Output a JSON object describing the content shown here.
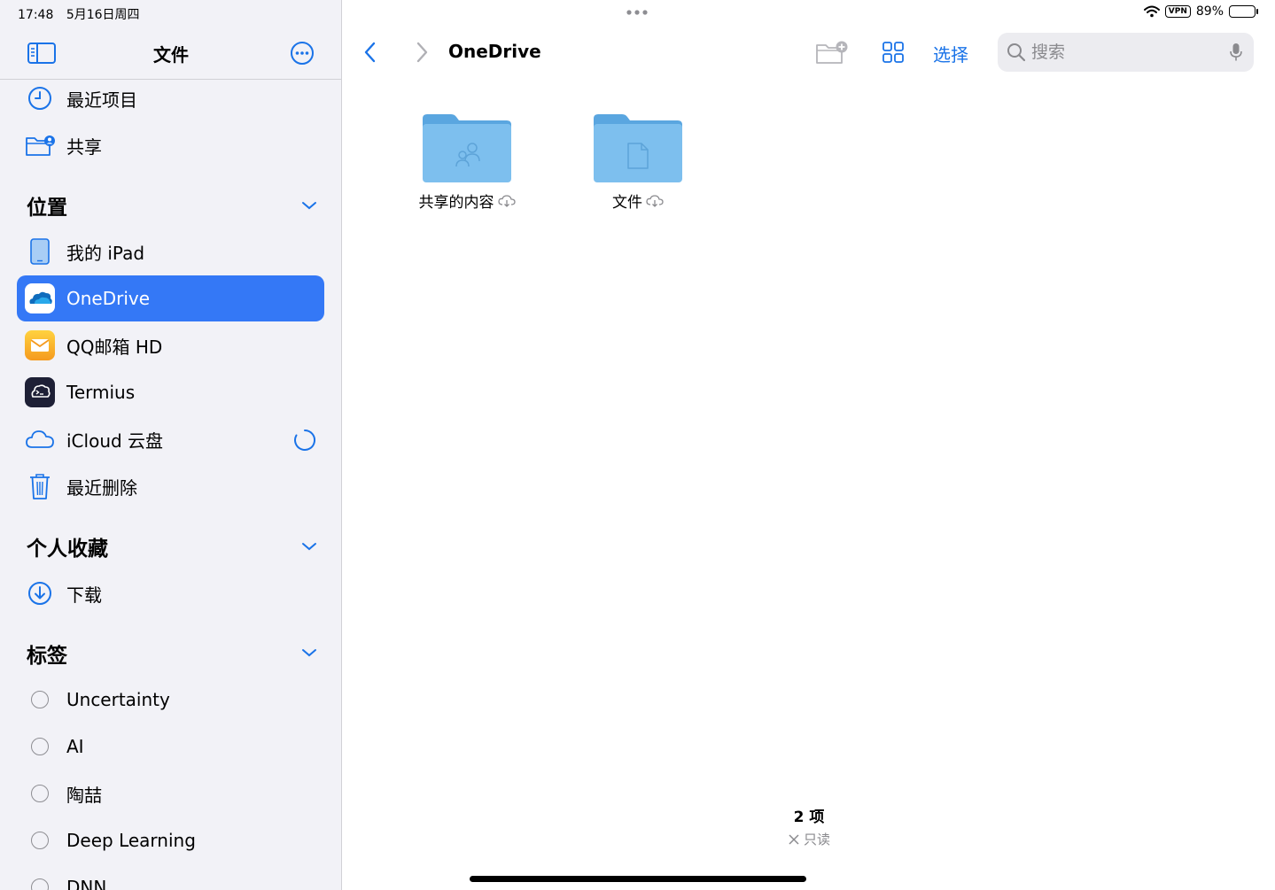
{
  "status": {
    "time": "17:48",
    "date": "5月16日周四",
    "vpn": "VPN",
    "battery": "89%",
    "battery_level": 0.89
  },
  "sidebar": {
    "title": "文件",
    "quick": [
      {
        "label": "最近项目",
        "icon": "clock-icon"
      },
      {
        "label": "共享",
        "icon": "shared-folder-icon"
      }
    ],
    "locations_header": "位置",
    "locations": [
      {
        "label": "我的 iPad",
        "icon": "ipad-icon"
      },
      {
        "label": "OneDrive",
        "icon": "onedrive-icon",
        "selected": true
      },
      {
        "label": "QQ邮箱 HD",
        "icon": "mail-icon"
      },
      {
        "label": "Termius",
        "icon": "termius-icon"
      },
      {
        "label": "iCloud 云盘",
        "icon": "cloud-icon"
      },
      {
        "label": "最近删除",
        "icon": "trash-icon"
      }
    ],
    "favorites_header": "个人收藏",
    "favorites": [
      {
        "label": "下载",
        "icon": "download-icon"
      }
    ],
    "tags_header": "标签",
    "tags": [
      {
        "label": "Uncertainty"
      },
      {
        "label": "AI"
      },
      {
        "label": "陶喆"
      },
      {
        "label": "Deep Learning"
      },
      {
        "label": "DNN"
      }
    ]
  },
  "toolbar": {
    "title": "OneDrive",
    "select_label": "选择",
    "search_placeholder": "搜索"
  },
  "files": [
    {
      "name": "共享的内容",
      "icon": "shared-folder-icon"
    },
    {
      "name": "文件",
      "icon": "document-folder-icon"
    }
  ],
  "footer": {
    "count": "2 项",
    "readonly": "只读"
  },
  "colors": {
    "accent": "#3478f6",
    "folder": "#7dbfee",
    "sidebar_bg": "#f2f2f7"
  }
}
